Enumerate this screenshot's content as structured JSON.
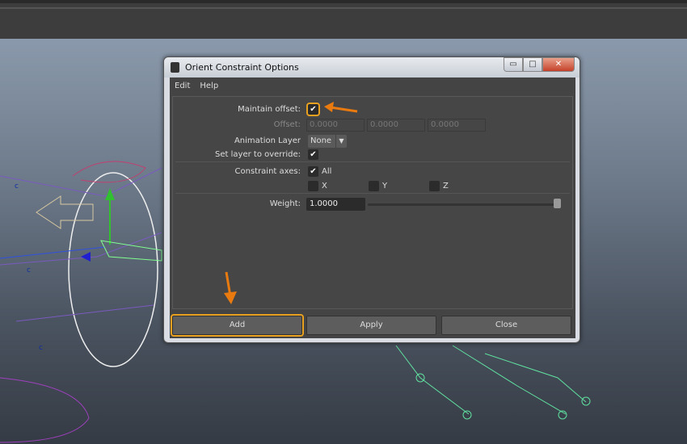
{
  "dialog": {
    "title": "Orient Constraint Options",
    "window_buttons": {
      "minimize": "▭",
      "maximize": "□",
      "close": "✕"
    },
    "menu": [
      "Edit",
      "Help"
    ],
    "maintain_offset": {
      "label": "Maintain offset:",
      "checked": true,
      "check": "✔"
    },
    "offset": {
      "label": "Offset:",
      "values": [
        "0.0000",
        "0.0000",
        "0.0000"
      ]
    },
    "animation_layer": {
      "label": "Animation Layer",
      "value": "None",
      "arrow": "▼"
    },
    "set_layer_override": {
      "label": "Set layer to override:",
      "checked": true,
      "check": "✔"
    },
    "constraint_axes": {
      "label": "Constraint axes:",
      "all": "All",
      "all_checked": true,
      "check": "✔",
      "axes": [
        "X",
        "Y",
        "Z"
      ]
    },
    "weight": {
      "label": "Weight:",
      "value": "1.0000",
      "slider_fraction": 1.0
    },
    "buttons": {
      "add": "Add",
      "apply": "Apply",
      "close": "Close"
    }
  },
  "colors": {
    "highlight": "#e8a020",
    "arrow": "#e87a10"
  }
}
